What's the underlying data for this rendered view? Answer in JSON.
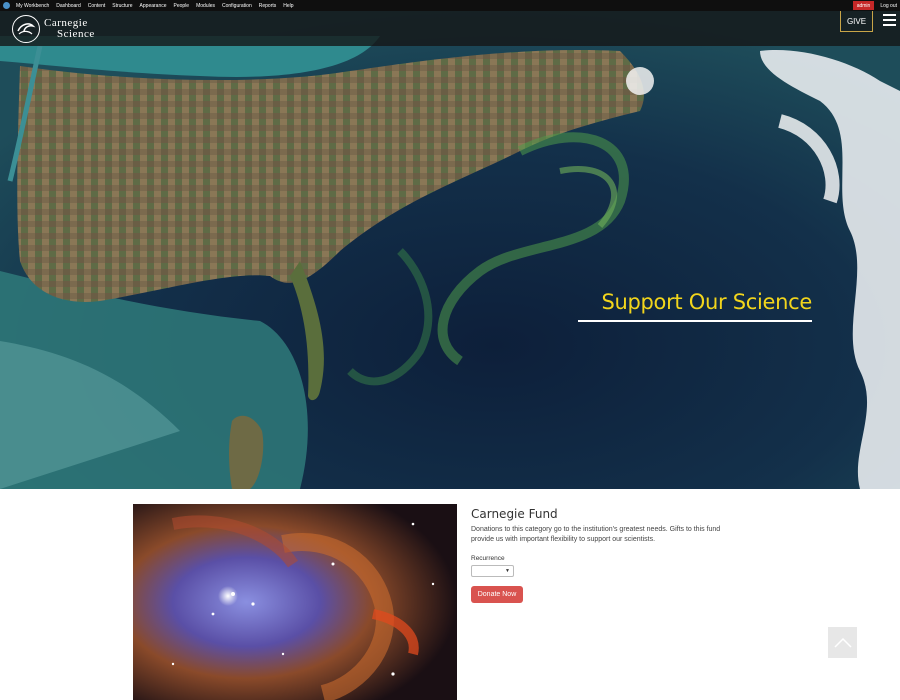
{
  "admin_bar": {
    "menu": [
      "My Workbench",
      "Dashboard",
      "Content",
      "Structure",
      "Appearance",
      "People",
      "Modules",
      "Configuration",
      "Reports",
      "Help"
    ],
    "user": "admin",
    "logout": "Log out"
  },
  "header": {
    "logo_line1": "Carnegie",
    "logo_line2": "Science",
    "give_label": "GIVE"
  },
  "hero": {
    "title": "Support Our Science"
  },
  "fund": {
    "title": "Carnegie Fund",
    "description": "Donations to this category go to the institution's greatest needs. Gifts to this fund provide us with important flexibility to support our scientists.",
    "recurrence_label": "Recurrence",
    "recurrence_value": "",
    "donate_label": "Donate Now"
  },
  "colors": {
    "accent_yellow": "#f2d51c",
    "donate_red": "#d9534f",
    "admin_red": "#c62828"
  }
}
